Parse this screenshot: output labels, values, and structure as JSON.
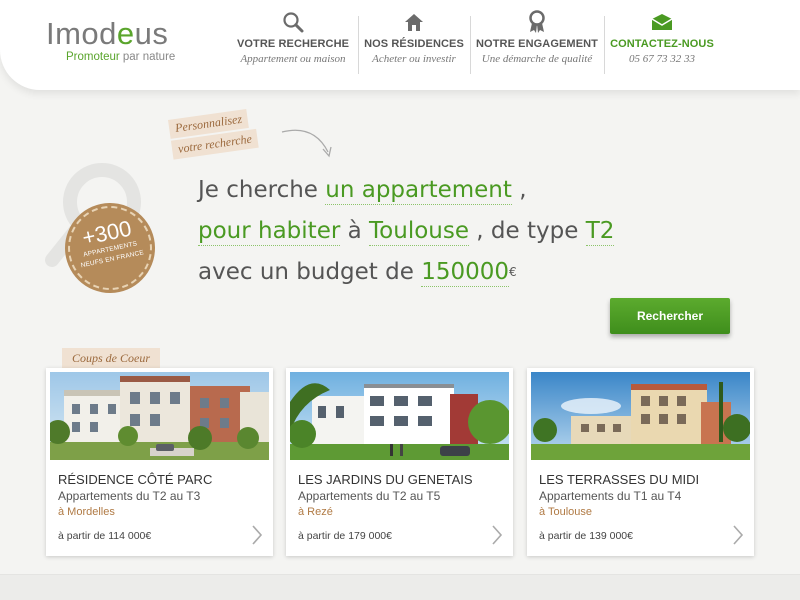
{
  "brand": {
    "logo_text_a": "Imod",
    "logo_text_b": "e",
    "logo_text_c": "us",
    "tagline_a": "Promoteur",
    "tagline_b": " par nature",
    "accent_color": "#5aa52c"
  },
  "nav": [
    {
      "title": "VOTRE RECHERCHE",
      "sub": "Appartement ou maison",
      "icon": "search-icon"
    },
    {
      "title": "NOS RÉSIDENCES",
      "sub": "Acheter ou investir",
      "icon": "house-icon"
    },
    {
      "title": "NOTRE ENGAGEMENT",
      "sub": "Une démarche de qualité",
      "icon": "award-icon"
    },
    {
      "title": "CONTACTEZ-NOUS",
      "sub": "05 67 73 32 33",
      "icon": "mail-icon"
    }
  ],
  "search": {
    "perso_line1": "Personnalisez",
    "perso_line2": "votre recherche",
    "badge_number": "+300",
    "badge_line1": "APPARTEMENTS",
    "badge_line2": "NEUFS EN FRANCE",
    "text_1": "Je cherche ",
    "value_type": "un appartement",
    "text_2": " ,",
    "value_purpose": "pour habiter",
    "text_3": " à ",
    "value_city": "Toulouse",
    "text_4": " , de type ",
    "value_size": "T2",
    "text_5": "avec un budget de ",
    "value_budget": "150000",
    "currency": "€",
    "button_label": "Rechercher"
  },
  "featured": {
    "label": "Coups de Coeur",
    "cards": [
      {
        "title": "RÉSIDENCE CÔTÉ PARC",
        "subtitle": "Appartements du T2 au T3",
        "city": "à Mordelles",
        "price": "à partir de 114 000€"
      },
      {
        "title": "LES JARDINS DU GENETAIS",
        "subtitle": "Appartements du T2 au T5",
        "city": "à Rezé",
        "price": "à partir de 179 000€"
      },
      {
        "title": "LES TERRASSES DU MIDI",
        "subtitle": "Appartements du T1 au T4",
        "city": "à Toulouse",
        "price": "à partir de 139 000€"
      }
    ]
  }
}
